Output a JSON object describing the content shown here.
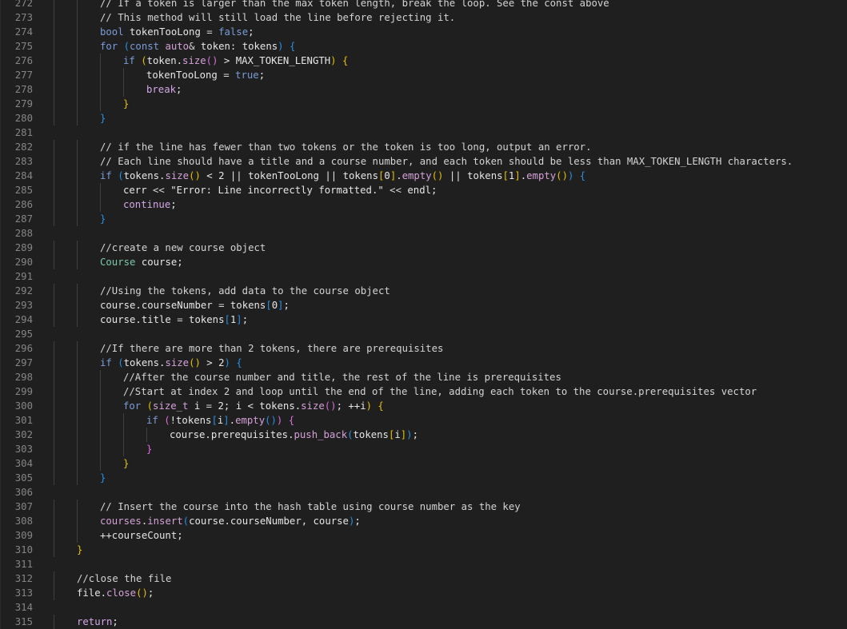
{
  "editor": {
    "lines": [
      {
        "n": "272",
        "indent": 2,
        "tokens": [
          [
            "c",
            "// If a token is larger than the max token length, break the loop. See the const above"
          ]
        ]
      },
      {
        "n": "273",
        "indent": 2,
        "tokens": [
          [
            "c",
            "// This method will still load the line before rejecting it."
          ]
        ]
      },
      {
        "n": "274",
        "indent": 2,
        "tokens": [
          [
            "k",
            "bool"
          ],
          [
            "p",
            " tokenTooLong "
          ],
          [
            "o",
            "="
          ],
          [
            "p",
            " "
          ],
          [
            "k",
            "false"
          ],
          [
            "p",
            ";"
          ]
        ]
      },
      {
        "n": "275",
        "indent": 2,
        "tokens": [
          [
            "k",
            "for"
          ],
          [
            "p",
            " "
          ],
          [
            "b3",
            "("
          ],
          [
            "k",
            "const"
          ],
          [
            "p",
            " "
          ],
          [
            "y",
            "auto"
          ],
          [
            "o",
            "&"
          ],
          [
            "p",
            " token: tokens"
          ],
          [
            "b3",
            ")"
          ],
          [
            "p",
            " "
          ],
          [
            "b3",
            "{"
          ]
        ]
      },
      {
        "n": "276",
        "indent": 3,
        "tokens": [
          [
            "k",
            "if"
          ],
          [
            "p",
            " "
          ],
          [
            "b1",
            "("
          ],
          [
            "p",
            "token."
          ],
          [
            "m",
            "size"
          ],
          [
            "b2",
            "()"
          ],
          [
            "p",
            " > MAX_TOKEN_LENGTH"
          ],
          [
            "b1",
            ")"
          ],
          [
            "p",
            " "
          ],
          [
            "b1",
            "{"
          ]
        ]
      },
      {
        "n": "277",
        "indent": 4,
        "tokens": [
          [
            "p",
            "tokenTooLong "
          ],
          [
            "o",
            "="
          ],
          [
            "p",
            " "
          ],
          [
            "k",
            "true"
          ],
          [
            "p",
            ";"
          ]
        ]
      },
      {
        "n": "278",
        "indent": 4,
        "tokens": [
          [
            "x",
            "break"
          ],
          [
            "p",
            ";"
          ]
        ]
      },
      {
        "n": "279",
        "indent": 3,
        "tokens": [
          [
            "b1",
            "}"
          ]
        ]
      },
      {
        "n": "280",
        "indent": 2,
        "tokens": [
          [
            "b3",
            "}"
          ]
        ]
      },
      {
        "n": "281",
        "indent": 0,
        "tokens": []
      },
      {
        "n": "282",
        "indent": 2,
        "tokens": [
          [
            "c",
            "// if the line has fewer than two tokens or the token is too long, output an error."
          ]
        ]
      },
      {
        "n": "283",
        "indent": 2,
        "tokens": [
          [
            "c",
            "// Each line should have a title and a course number, and each token should be less than MAX_TOKEN_LENGTH characters."
          ]
        ]
      },
      {
        "n": "284",
        "indent": 2,
        "tokens": [
          [
            "k",
            "if"
          ],
          [
            "p",
            " "
          ],
          [
            "b3",
            "("
          ],
          [
            "p",
            "tokens."
          ],
          [
            "m",
            "size"
          ],
          [
            "b1",
            "()"
          ],
          [
            "p",
            " < 2 || tokenTooLong || tokens"
          ],
          [
            "b1",
            "["
          ],
          [
            "p",
            "0"
          ],
          [
            "b1",
            "]"
          ],
          [
            "p",
            "."
          ],
          [
            "m",
            "empty"
          ],
          [
            "b1",
            "()"
          ],
          [
            "p",
            " || tokens"
          ],
          [
            "b1",
            "["
          ],
          [
            "p",
            "1"
          ],
          [
            "b1",
            "]"
          ],
          [
            "p",
            "."
          ],
          [
            "m",
            "empty"
          ],
          [
            "b1",
            "()"
          ],
          [
            "b3",
            ")"
          ],
          [
            "p",
            " "
          ],
          [
            "b3",
            "{"
          ]
        ]
      },
      {
        "n": "285",
        "indent": 3,
        "tokens": [
          [
            "p",
            "cerr "
          ],
          [
            "o",
            "<<"
          ],
          [
            "p",
            " \"Error: Line incorrectly formatted.\" "
          ],
          [
            "o",
            "<<"
          ],
          [
            "p",
            " endl;"
          ]
        ]
      },
      {
        "n": "286",
        "indent": 3,
        "tokens": [
          [
            "x",
            "continue"
          ],
          [
            "p",
            ";"
          ]
        ]
      },
      {
        "n": "287",
        "indent": 2,
        "tokens": [
          [
            "b3",
            "}"
          ]
        ]
      },
      {
        "n": "288",
        "indent": 0,
        "tokens": []
      },
      {
        "n": "289",
        "indent": 2,
        "tokens": [
          [
            "c",
            "//create a new course object"
          ]
        ]
      },
      {
        "n": "290",
        "indent": 2,
        "tokens": [
          [
            "t",
            "Course"
          ],
          [
            "p",
            " course;"
          ]
        ]
      },
      {
        "n": "291",
        "indent": 0,
        "tokens": []
      },
      {
        "n": "292",
        "indent": 2,
        "tokens": [
          [
            "c",
            "//Using the tokens, add data to the course object"
          ]
        ]
      },
      {
        "n": "293",
        "indent": 2,
        "tokens": [
          [
            "p",
            "course.courseNumber "
          ],
          [
            "o",
            "="
          ],
          [
            "p",
            " tokens"
          ],
          [
            "b3",
            "["
          ],
          [
            "p",
            "0"
          ],
          [
            "b3",
            "]"
          ],
          [
            "p",
            ";"
          ]
        ]
      },
      {
        "n": "294",
        "indent": 2,
        "tokens": [
          [
            "p",
            "course.title "
          ],
          [
            "o",
            "="
          ],
          [
            "p",
            " tokens"
          ],
          [
            "b3",
            "["
          ],
          [
            "p",
            "1"
          ],
          [
            "b3",
            "]"
          ],
          [
            "p",
            ";"
          ]
        ]
      },
      {
        "n": "295",
        "indent": 0,
        "tokens": []
      },
      {
        "n": "296",
        "indent": 2,
        "tokens": [
          [
            "c",
            "//If there are more than 2 tokens, there are prerequisites"
          ]
        ]
      },
      {
        "n": "297",
        "indent": 2,
        "tokens": [
          [
            "k",
            "if"
          ],
          [
            "p",
            " "
          ],
          [
            "b3",
            "("
          ],
          [
            "p",
            "tokens."
          ],
          [
            "m",
            "size"
          ],
          [
            "b1",
            "()"
          ],
          [
            "p",
            " > 2"
          ],
          [
            "b3",
            ")"
          ],
          [
            "p",
            " "
          ],
          [
            "b3",
            "{"
          ]
        ]
      },
      {
        "n": "298",
        "indent": 3,
        "tokens": [
          [
            "c",
            "//After the course number and title, the rest of the line is prerequisites"
          ]
        ]
      },
      {
        "n": "299",
        "indent": 3,
        "tokens": [
          [
            "c",
            "//Start at index 2 and loop until the end of the line, adding each token to the course.prerequisites vector"
          ]
        ]
      },
      {
        "n": "300",
        "indent": 3,
        "tokens": [
          [
            "k",
            "for"
          ],
          [
            "p",
            " "
          ],
          [
            "b1",
            "("
          ],
          [
            "y",
            "size_t"
          ],
          [
            "p",
            " i "
          ],
          [
            "o",
            "="
          ],
          [
            "p",
            " 2; i < tokens."
          ],
          [
            "m",
            "size"
          ],
          [
            "b2",
            "()"
          ],
          [
            "p",
            "; ++i"
          ],
          [
            "b1",
            ")"
          ],
          [
            "p",
            " "
          ],
          [
            "b1",
            "{"
          ]
        ]
      },
      {
        "n": "301",
        "indent": 4,
        "tokens": [
          [
            "k",
            "if"
          ],
          [
            "p",
            " "
          ],
          [
            "b2",
            "("
          ],
          [
            "p",
            "!tokens"
          ],
          [
            "b3",
            "["
          ],
          [
            "p",
            "i"
          ],
          [
            "b3",
            "]"
          ],
          [
            "p",
            "."
          ],
          [
            "m",
            "empty"
          ],
          [
            "b3",
            "()"
          ],
          [
            "b2",
            ")"
          ],
          [
            "p",
            " "
          ],
          [
            "b2",
            "{"
          ]
        ]
      },
      {
        "n": "302",
        "indent": 5,
        "tokens": [
          [
            "p",
            "course.prerequisites."
          ],
          [
            "m",
            "push_back"
          ],
          [
            "b3",
            "("
          ],
          [
            "p",
            "tokens"
          ],
          [
            "b1",
            "["
          ],
          [
            "p",
            "i"
          ],
          [
            "b1",
            "]"
          ],
          [
            "b3",
            ")"
          ],
          [
            "p",
            ";"
          ]
        ]
      },
      {
        "n": "303",
        "indent": 4,
        "tokens": [
          [
            "b2",
            "}"
          ]
        ]
      },
      {
        "n": "304",
        "indent": 3,
        "tokens": [
          [
            "b1",
            "}"
          ]
        ]
      },
      {
        "n": "305",
        "indent": 2,
        "tokens": [
          [
            "b3",
            "}"
          ]
        ]
      },
      {
        "n": "306",
        "indent": 0,
        "tokens": []
      },
      {
        "n": "307",
        "indent": 2,
        "tokens": [
          [
            "c",
            "// Insert the course into the hash table using course number as the key"
          ]
        ]
      },
      {
        "n": "308",
        "indent": 2,
        "tokens": [
          [
            "y",
            "courses"
          ],
          [
            "p",
            "."
          ],
          [
            "m",
            "insert"
          ],
          [
            "b3",
            "("
          ],
          [
            "p",
            "course.courseNumber, course"
          ],
          [
            "b3",
            ")"
          ],
          [
            "p",
            ";"
          ]
        ]
      },
      {
        "n": "309",
        "indent": 2,
        "tokens": [
          [
            "p",
            "++courseCount;"
          ]
        ]
      },
      {
        "n": "310",
        "indent": 1,
        "tokens": [
          [
            "b1",
            "}"
          ]
        ]
      },
      {
        "n": "311",
        "indent": 0,
        "tokens": []
      },
      {
        "n": "312",
        "indent": 1,
        "tokens": [
          [
            "c",
            "//close the file"
          ]
        ]
      },
      {
        "n": "313",
        "indent": 1,
        "tokens": [
          [
            "p",
            "file."
          ],
          [
            "m",
            "close"
          ],
          [
            "b1",
            "()"
          ],
          [
            "p",
            ";"
          ]
        ]
      },
      {
        "n": "314",
        "indent": 0,
        "tokens": []
      },
      {
        "n": "315",
        "indent": 1,
        "tokens": [
          [
            "x",
            "return"
          ],
          [
            "p",
            ";"
          ]
        ]
      }
    ]
  },
  "colors": {
    "background": "#1f1f1f",
    "line_number": "#858585",
    "comment": "#d4d4d4",
    "keyword": "#7a9cd9",
    "type": "#7cc9a8",
    "method": "#d5a1d8",
    "bracket_gold": "#e5c000",
    "bracket_pink": "#d86edb",
    "bracket_blue": "#2b8fe0"
  }
}
